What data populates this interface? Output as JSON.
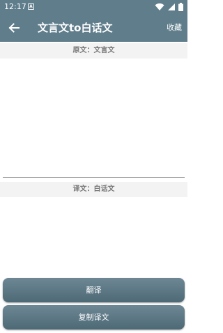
{
  "status_bar": {
    "time": "12:17",
    "notification_icon": "A"
  },
  "app_bar": {
    "back_icon": "arrow-left-icon",
    "title": "文言文to白话文",
    "favorite_label": "收藏"
  },
  "source": {
    "header": "原文：文言文",
    "value": ""
  },
  "target": {
    "header": "译文：白话文",
    "value": ""
  },
  "buttons": {
    "translate": "翻译",
    "copy": "复制译文"
  },
  "colors": {
    "primary": "#607d8b",
    "button": "#5a7482",
    "section_bg": "#f3f3f3",
    "section_text": "#777777"
  }
}
